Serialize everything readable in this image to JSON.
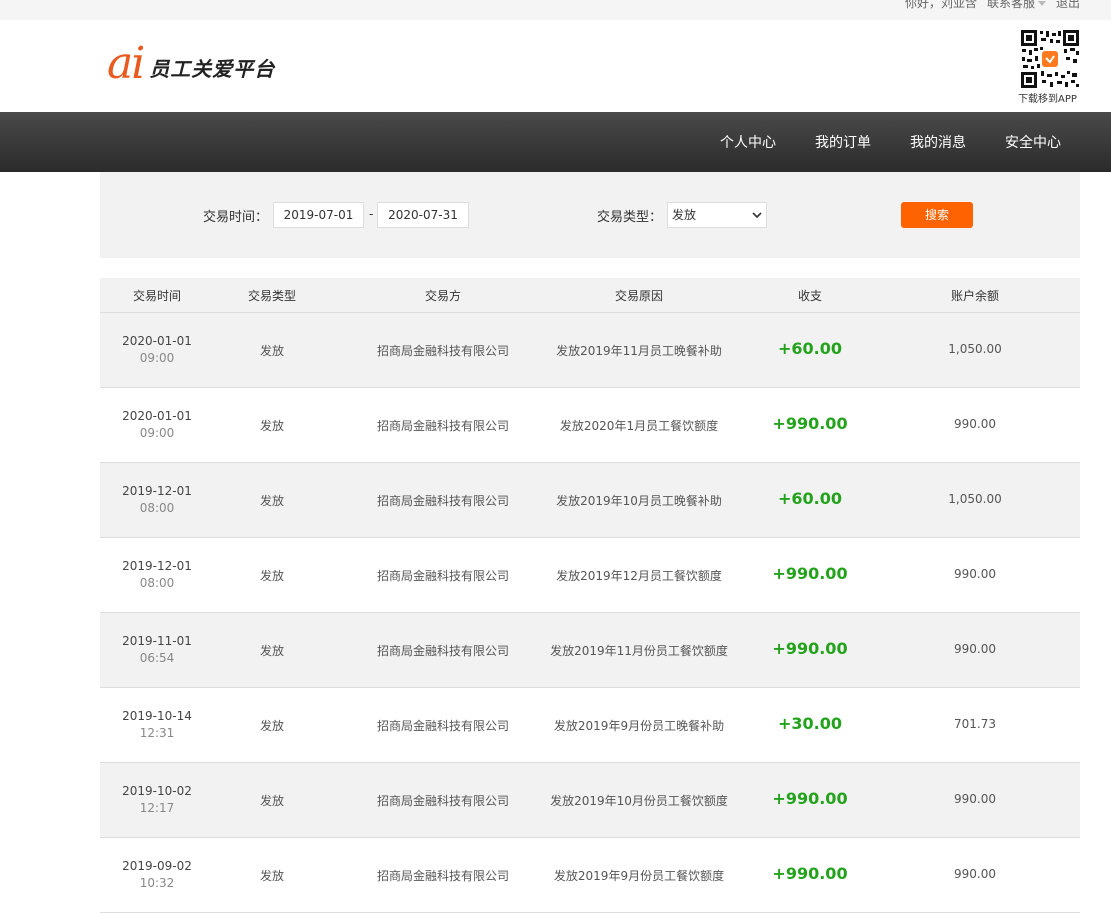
{
  "topbar": {
    "greeting": "你好，刘亚含",
    "customer_service": "联系客服",
    "logout": "退出"
  },
  "header": {
    "logo_mark": "ai",
    "logo_text": "员工关爱平台",
    "qr_caption": "下载移到APP"
  },
  "nav": {
    "items": [
      "个人中心",
      "我的订单",
      "我的消息",
      "安全中心"
    ]
  },
  "filter": {
    "time_label": "交易时间：",
    "start_date": "2019-07-01",
    "separator": "-",
    "end_date": "2020-07-31",
    "type_label": "交易类型：",
    "type_selected": "发放",
    "search_button": "搜索"
  },
  "table": {
    "columns": [
      "交易时间",
      "交易类型",
      "交易方",
      "交易原因",
      "收支",
      "账户余额"
    ],
    "rows": [
      {
        "date": "2020-01-01",
        "time": "09:00",
        "type": "发放",
        "party": "招商局金融科技有限公司",
        "reason": "发放2019年11月员工晚餐补助",
        "amount": "+60.00",
        "balance": "1,050.00"
      },
      {
        "date": "2020-01-01",
        "time": "09:00",
        "type": "发放",
        "party": "招商局金融科技有限公司",
        "reason": "发放2020年1月员工餐饮额度",
        "amount": "+990.00",
        "balance": "990.00"
      },
      {
        "date": "2019-12-01",
        "time": "08:00",
        "type": "发放",
        "party": "招商局金融科技有限公司",
        "reason": "发放2019年10月员工晚餐补助",
        "amount": "+60.00",
        "balance": "1,050.00"
      },
      {
        "date": "2019-12-01",
        "time": "08:00",
        "type": "发放",
        "party": "招商局金融科技有限公司",
        "reason": "发放2019年12月员工餐饮额度",
        "amount": "+990.00",
        "balance": "990.00"
      },
      {
        "date": "2019-11-01",
        "time": "06:54",
        "type": "发放",
        "party": "招商局金融科技有限公司",
        "reason": "发放2019年11月份员工餐饮额度",
        "amount": "+990.00",
        "balance": "990.00"
      },
      {
        "date": "2019-10-14",
        "time": "12:31",
        "type": "发放",
        "party": "招商局金融科技有限公司",
        "reason": "发放2019年9月份员工晚餐补助",
        "amount": "+30.00",
        "balance": "701.73"
      },
      {
        "date": "2019-10-02",
        "time": "12:17",
        "type": "发放",
        "party": "招商局金融科技有限公司",
        "reason": "发放2019年10月份员工餐饮额度",
        "amount": "+990.00",
        "balance": "990.00"
      },
      {
        "date": "2019-09-02",
        "time": "10:32",
        "type": "发放",
        "party": "招商局金融科技有限公司",
        "reason": "发放2019年9月份员工餐饮额度",
        "amount": "+990.00",
        "balance": "990.00"
      }
    ]
  },
  "colors": {
    "brand_orange": "#e95a20",
    "search_button": "#ff6200",
    "income_green": "#23a31b",
    "nav_dark": "#2b2b2b"
  },
  "icons": {
    "dropdown": "caret-down-icon",
    "qr": "qr-code-icon",
    "select_chevron": "chevron-down-icon"
  }
}
